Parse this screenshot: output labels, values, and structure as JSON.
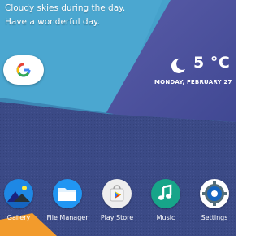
{
  "weather_text": {
    "line1": "Cloudy skies during the day.",
    "line2": "Have a wonderful day."
  },
  "search_widget": {
    "icon": "google-g-icon",
    "colors": {
      "blue": "#4285F4",
      "red": "#EA4335",
      "yellow": "#FBBC05",
      "green": "#34A853"
    }
  },
  "weather_widget": {
    "icon": "moon-icon",
    "temperature": "5 °C",
    "date": "MONDAY, FEBRUARY 27"
  },
  "dock": {
    "apps": [
      {
        "label": "Gallery",
        "icon": "gallery-icon",
        "color": "#1e88e5"
      },
      {
        "label": "File Manager",
        "icon": "folder-icon",
        "color": "#2196f3"
      },
      {
        "label": "Play Store",
        "icon": "play-store-icon",
        "color": "#eeeeee"
      },
      {
        "label": "Music",
        "icon": "music-note-icon",
        "color": "#17a589"
      },
      {
        "label": "Settings",
        "icon": "gear-icon",
        "color": "#ffffff"
      }
    ]
  },
  "wallpaper": {
    "sky": "#4a9fc9",
    "purple": "#4e4f9c",
    "fabric": "#3a4884"
  }
}
